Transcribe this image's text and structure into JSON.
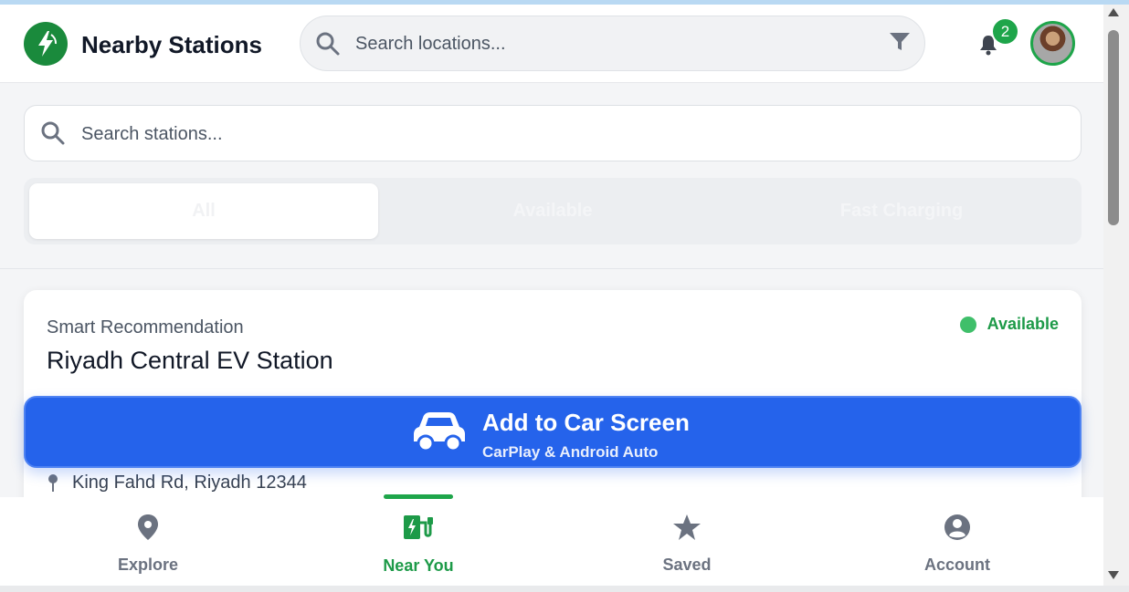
{
  "header": {
    "title": "Nearby Stations",
    "search_placeholder": "Search locations...",
    "notification_count": "2"
  },
  "station_search": {
    "placeholder": "Search stations..."
  },
  "filter_tabs": [
    {
      "label": "All",
      "active": true
    },
    {
      "label": "Available",
      "active": false
    },
    {
      "label": "Fast Charging",
      "active": false
    }
  ],
  "recommendation": {
    "label": "Smart Recommendation",
    "station_name": "Riyadh Central EV Station",
    "status": "Available",
    "address": "King Fahd Rd, Riyadh 12344"
  },
  "car_screen": {
    "title": "Add to Car Screen",
    "subtitle": "CarPlay & Android Auto"
  },
  "bottom_nav": [
    {
      "label": "Explore",
      "icon": "map-pin-icon",
      "active": false
    },
    {
      "label": "Near You",
      "icon": "ev-charger-icon",
      "active": true
    },
    {
      "label": "Saved",
      "icon": "star-icon",
      "active": false
    },
    {
      "label": "Account",
      "icon": "user-circle-icon",
      "active": false
    }
  ],
  "colors": {
    "brand_green": "#1a8a3c",
    "accent_green": "#1ea54a",
    "primary_blue": "#2563eb"
  }
}
